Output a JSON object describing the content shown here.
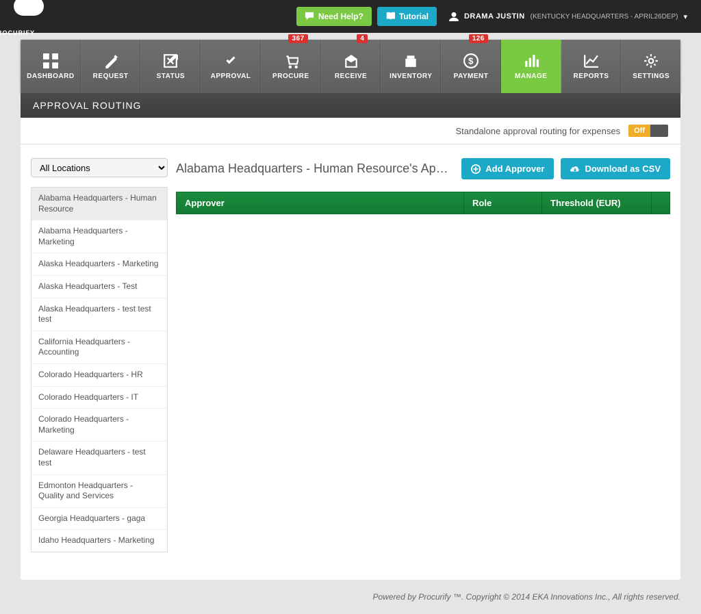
{
  "brand": "PROCURIFY",
  "topbar": {
    "help_label": "Need Help?",
    "tutorial_label": "Tutorial",
    "user_name": "DRAMA JUSTIN",
    "user_dept": "(KENTUCKY HEADQUARTERS - APRIL26DEP)"
  },
  "nav": {
    "items": [
      {
        "label": "DASHBOARD",
        "icon": "dashboard"
      },
      {
        "label": "REQUEST",
        "icon": "request"
      },
      {
        "label": "STATUS",
        "icon": "status"
      },
      {
        "label": "APPROVAL",
        "icon": "approval"
      },
      {
        "label": "PROCURE",
        "icon": "procure",
        "badge": "367"
      },
      {
        "label": "RECEIVE",
        "icon": "receive",
        "badge": "4"
      },
      {
        "label": "INVENTORY",
        "icon": "inventory"
      },
      {
        "label": "PAYMENT",
        "icon": "payment",
        "badge": "126"
      },
      {
        "label": "MANAGE",
        "icon": "manage",
        "active": true
      },
      {
        "label": "REPORTS",
        "icon": "reports"
      },
      {
        "label": "SETTINGS",
        "icon": "settings"
      }
    ]
  },
  "page": {
    "title": "APPROVAL ROUTING",
    "subbar_text": "Standalone approval routing for expenses",
    "toggle_label": "Off"
  },
  "sidebar": {
    "select_value": "All Locations",
    "items": [
      "Alabama Headquarters - Human Resource",
      "Alabama Headquarters - Marketing",
      "Alaska Headquarters - Marketing",
      "Alaska Headquarters - Test",
      "Alaska Headquarters - test test test",
      "California Headquarters - Accounting",
      "Colorado Headquarters - HR",
      "Colorado Headquarters - IT",
      "Colorado Headquarters - Marketing",
      "Delaware Headquarters - test test",
      "Edmonton Headquarters - Quality and Services",
      "Georgia Headquarters - gaga",
      "Idaho Headquarters - Marketing"
    ],
    "selected_index": 0
  },
  "panel": {
    "title": "Alabama Headquarters - Human Resource's Approval Or…",
    "add_label": "Add Approver",
    "download_label": "Download as CSV",
    "columns": {
      "approver": "Approver",
      "role": "Role",
      "threshold": "Threshold (EUR)"
    }
  },
  "footer": "Powered by Procurify ™. Copyright © 2014 EKA Innovations Inc., All rights reserved."
}
